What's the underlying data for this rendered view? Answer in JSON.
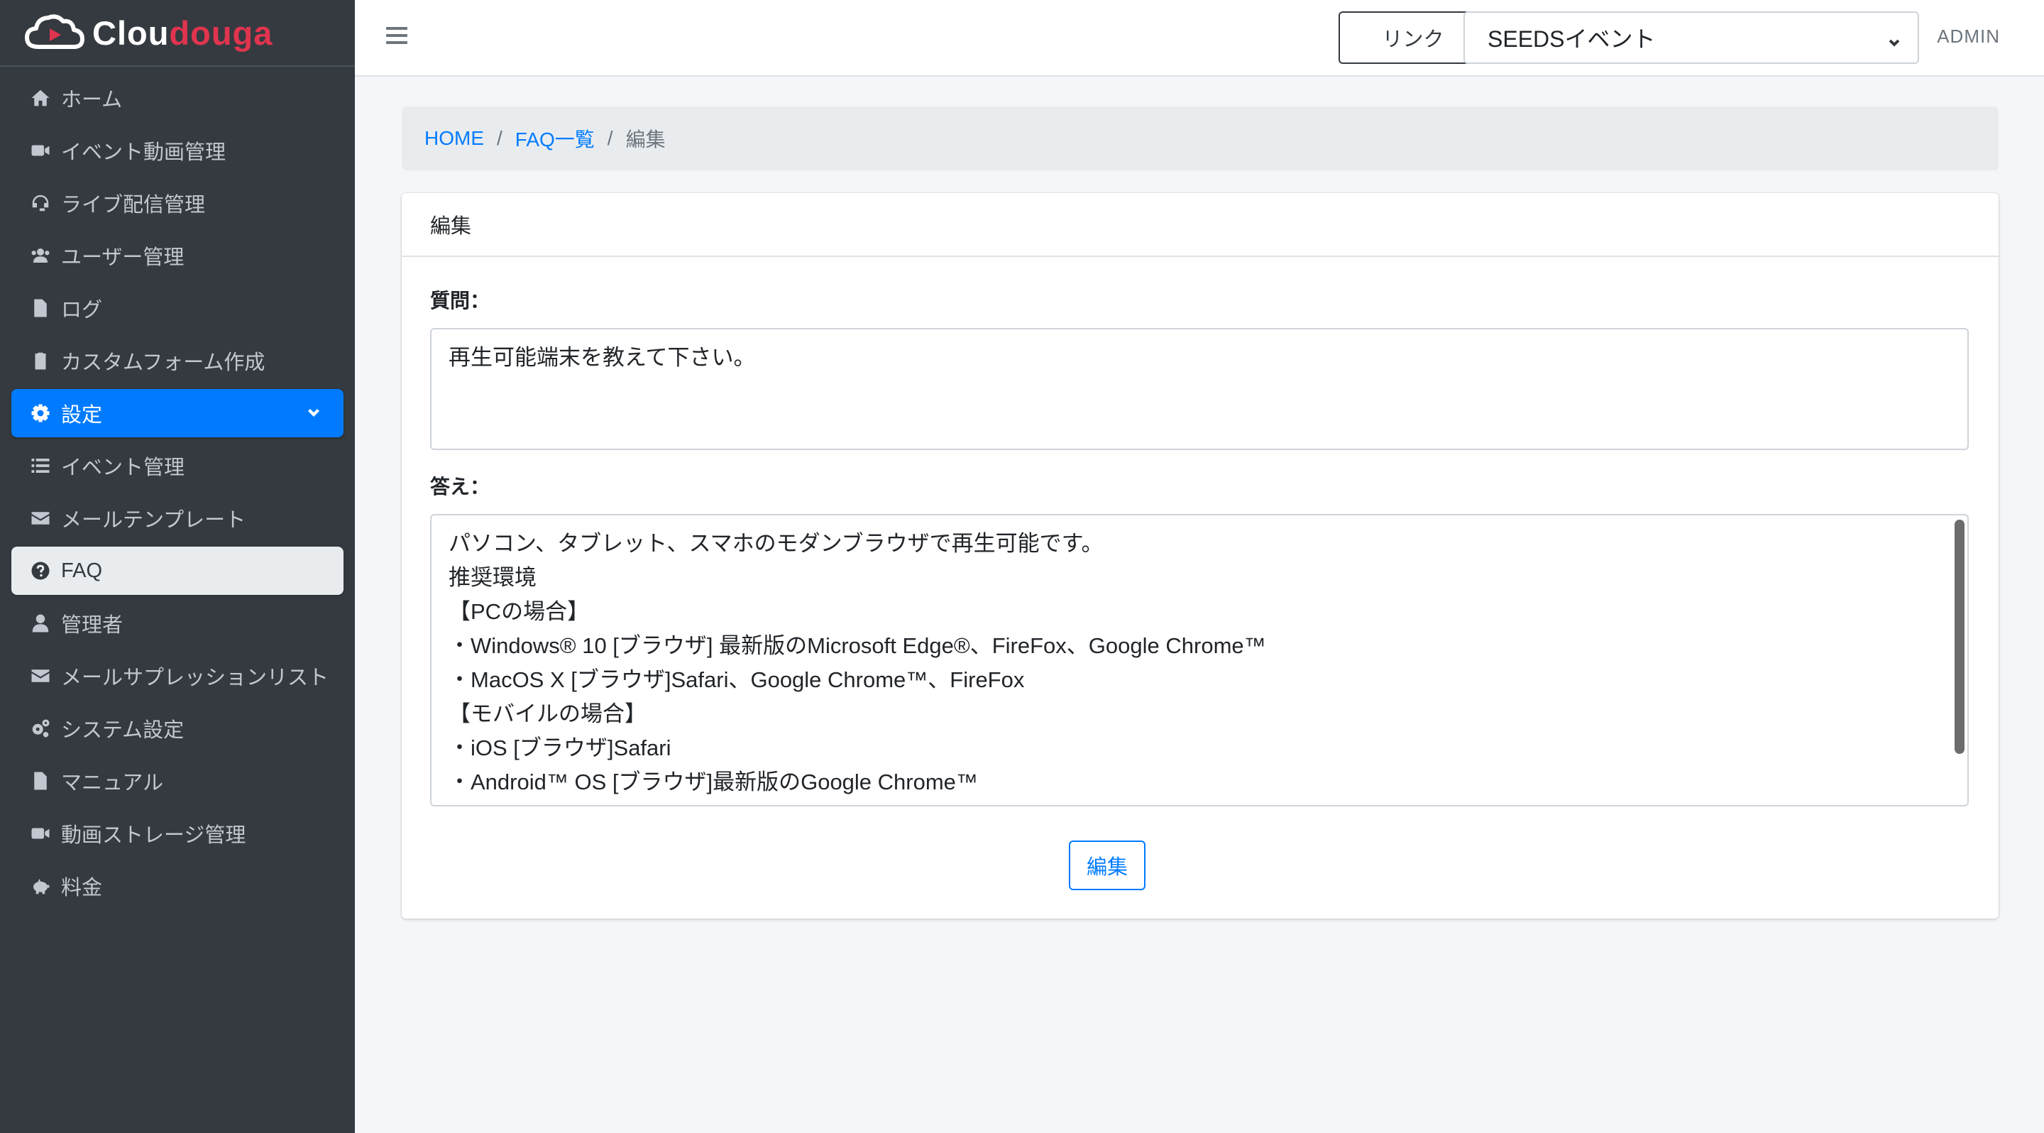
{
  "brand": {
    "name_part1": "Clou",
    "name_part2": "douga"
  },
  "sidebar": {
    "items": [
      {
        "label": "ホーム",
        "icon": "home-icon"
      },
      {
        "label": "イベント動画管理",
        "icon": "video-camera-icon"
      },
      {
        "label": "ライブ配信管理",
        "icon": "headset-icon"
      },
      {
        "label": "ユーザー管理",
        "icon": "users-icon"
      },
      {
        "label": "ログ",
        "icon": "file-icon"
      },
      {
        "label": "カスタムフォーム作成",
        "icon": "clipboard-icon"
      },
      {
        "label": "設定",
        "icon": "gear-icon",
        "state": "open"
      },
      {
        "label": "イベント管理",
        "icon": "list-icon"
      },
      {
        "label": "メールテンプレート",
        "icon": "envelope-icon"
      },
      {
        "label": "FAQ",
        "icon": "question-circle-icon",
        "state": "current"
      },
      {
        "label": "管理者",
        "icon": "user-icon"
      },
      {
        "label": "メールサプレッションリスト",
        "icon": "envelope-icon"
      },
      {
        "label": "システム設定",
        "icon": "gears-icon"
      },
      {
        "label": "マニュアル",
        "icon": "file-icon"
      },
      {
        "label": "動画ストレージ管理",
        "icon": "video-camera-icon"
      },
      {
        "label": "料金",
        "icon": "piggy-bank-icon"
      }
    ]
  },
  "topbar": {
    "link_label": "リンク",
    "event_select": {
      "selected": "SEEDSイベント"
    },
    "user": "ADMIN"
  },
  "breadcrumb": {
    "home": "HOME",
    "faq_list": "FAQ一覧",
    "current": "編集"
  },
  "card": {
    "title": "編集",
    "question_label": "質問：",
    "question_value": "再生可能端末を教えて下さい。",
    "answer_label": "答え：",
    "answer_lines": [
      "パソコン、タブレット、スマホのモダンブラウザで再生可能です。",
      "推奨環境",
      "【PCの場合】",
      "・Windows® 10 [ブラウザ] 最新版のMicrosoft Edge®、FireFox、Google Chrome™",
      "・MacOS X [ブラウザ]Safari、Google Chrome™、FireFox",
      "【モバイルの場合】",
      "・iOS [ブラウザ]Safari",
      "・Android™ OS [ブラウザ]最新版のGoogle Chrome™"
    ],
    "submit_label": "編集"
  },
  "colors": {
    "sidebar_bg": "#343a40",
    "primary": "#007bff",
    "brand_accent": "#e0344e"
  }
}
